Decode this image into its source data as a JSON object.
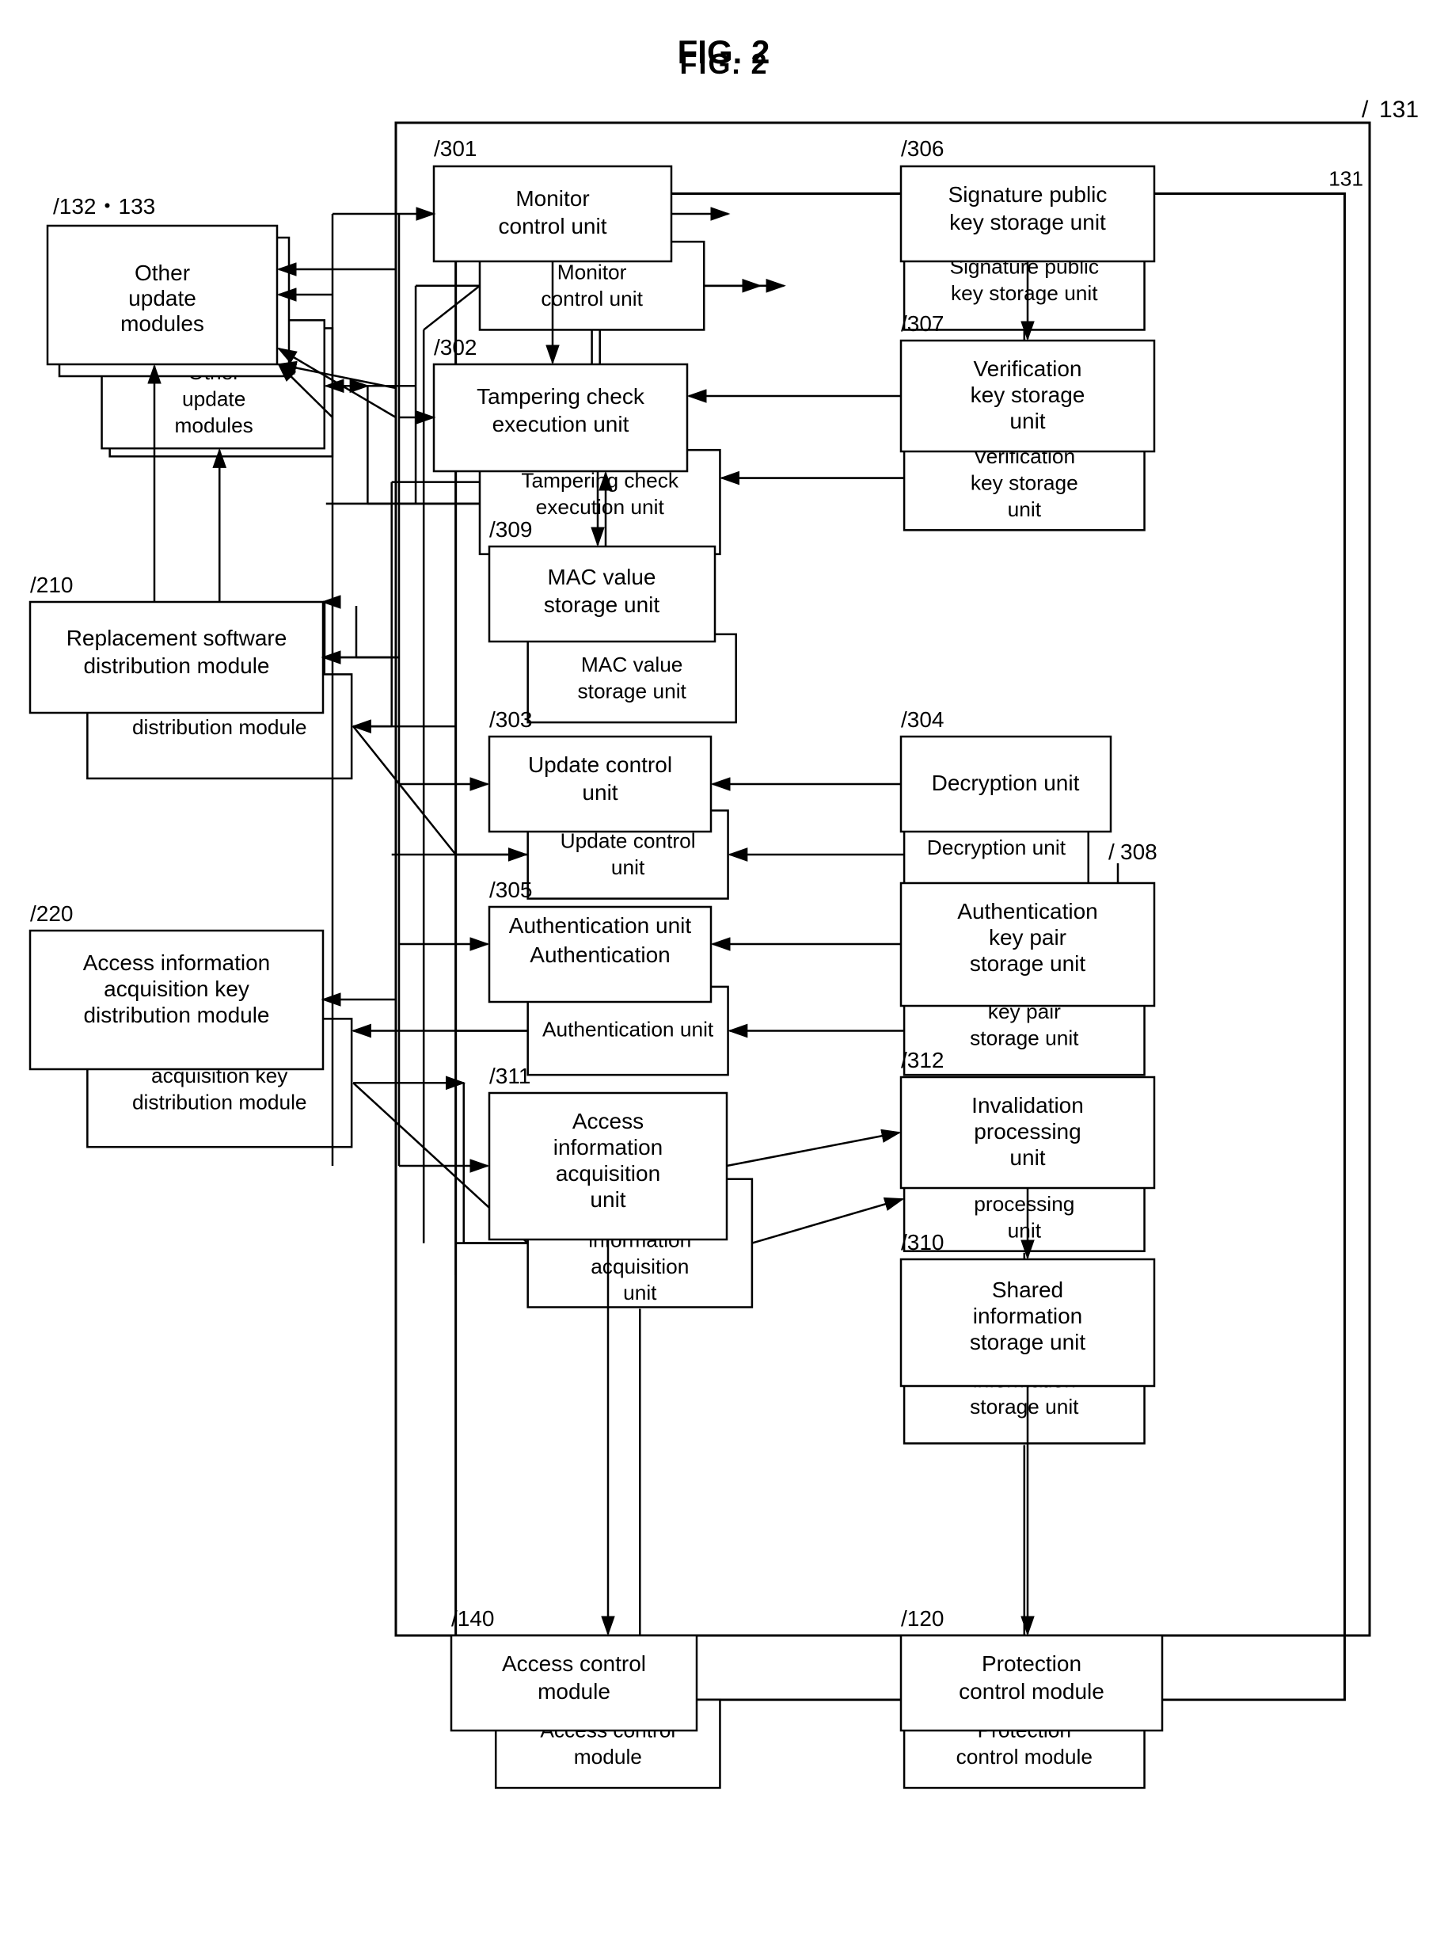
{
  "title": "FIG. 2",
  "nodes": {
    "ref131": "131",
    "ref132133": "132・133",
    "ref210": "210",
    "ref220": "220",
    "ref301": "301",
    "ref302": "302",
    "ref303": "303",
    "ref304": "304",
    "ref305": "305",
    "ref306": "306",
    "ref307": "307",
    "ref308": "308",
    "ref309": "309",
    "ref310": "310",
    "ref311": "311",
    "ref312": "312",
    "ref140": "140",
    "ref120": "120"
  },
  "labels": {
    "otherUpdateModules": "Other update modules",
    "replacementSoftwareDistributionModule": "Replacement software distribution module",
    "accessInfoAcquisitionKeyDistributionModule": "Access information acquisition key distribution module",
    "monitorControlUnit": "Monitor control unit",
    "tamperingCheckExecutionUnit": "Tampering check execution unit",
    "updateControlUnit": "Update control unit",
    "decryptionUnit": "Decryption unit",
    "authenticationUnit": "Authentication unit",
    "signaturePublicKeyStorageUnit": "Signature public key storage unit",
    "verificationKeyStorageUnit": "Verification key storage unit",
    "macValueStorageUnit": "MAC value storage unit",
    "authenticationKeyPairStorageUnit": "Authentication key pair storage unit",
    "accessInformationAcquisitionUnit": "Access information acquisition unit",
    "invalidationProcessingUnit": "Invalidation processing unit",
    "sharedInformationStorageUnit": "Shared information storage unit",
    "accessControlModule": "Access control module",
    "protectionControlModule": "Protection control module"
  }
}
